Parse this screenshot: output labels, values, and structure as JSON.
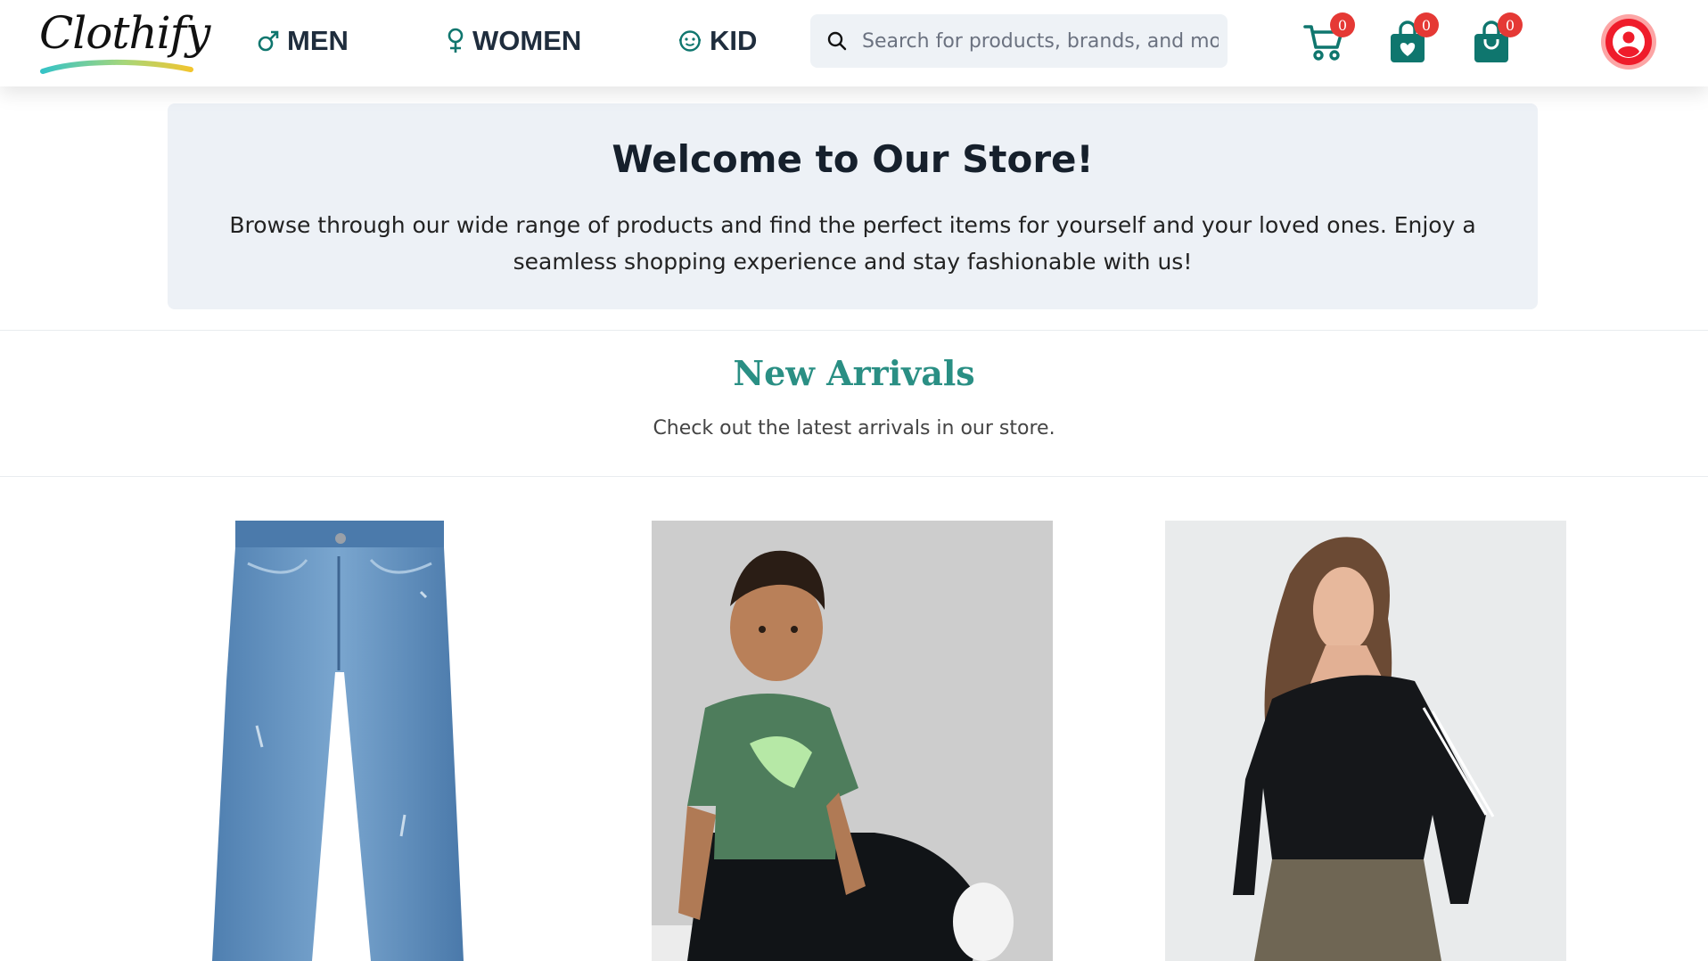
{
  "brand": {
    "name": "Clothify",
    "colors": {
      "accent": "#0f766e",
      "badge": "#e53935",
      "title": "#2a8f84"
    }
  },
  "nav": {
    "men": {
      "label": "MEN",
      "icon": "male-icon"
    },
    "women": {
      "label": "WOMEN",
      "icon": "female-icon"
    },
    "kid": {
      "label": "KID",
      "icon": "child-face-icon"
    }
  },
  "search": {
    "placeholder": "Search for products, brands, and more",
    "value": ""
  },
  "header_icons": {
    "cart": {
      "icon": "cart-icon",
      "count": "0"
    },
    "wishlist": {
      "icon": "heart-bag-icon",
      "count": "0"
    },
    "bag": {
      "icon": "shopping-bag-icon",
      "count": "0"
    },
    "profile": {
      "icon": "user-avatar-icon"
    }
  },
  "welcome": {
    "title": "Welcome to Our Store!",
    "text": "Browse through our wide range of products and find the perfect items for yourself and your loved ones. Enjoy a seamless shopping experience and stay fashionable with us!"
  },
  "arrivals": {
    "title": "New Arrivals",
    "subtitle": "Check out the latest arrivals in our store."
  },
  "products": [
    {
      "image": "blue-flare-jeans"
    },
    {
      "image": "kid-green-puma-tshirt"
    },
    {
      "image": "woman-black-adidas-top"
    }
  ]
}
